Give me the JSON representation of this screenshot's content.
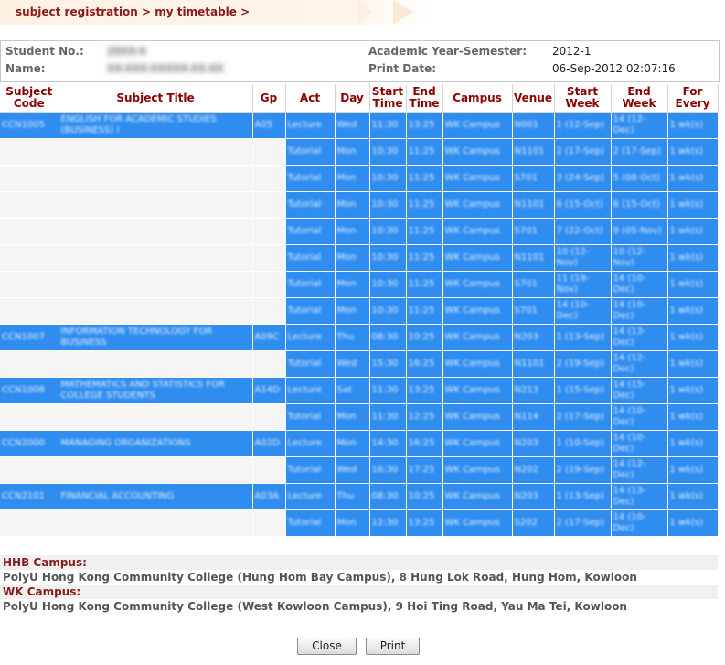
{
  "breadcrumb": "subject registration > my timetable >",
  "info": {
    "student_no_label": "Student No.:",
    "student_no_value": "20XX-X",
    "name_label": "Name:",
    "name_value": "XX-XXX-XXXXX-XX-XX",
    "year_label": "Academic Year-Semester:",
    "year_value": "2012-1",
    "print_label": "Print Date:",
    "print_value": "06-Sep-2012 02:07:16"
  },
  "columns": [
    "Subject Code",
    "Subject Title",
    "Gp",
    "Act",
    "Day",
    "Start Time",
    "End Time",
    "Campus",
    "Venue",
    "Start Week",
    "End Week",
    "For Every"
  ],
  "rows": [
    {
      "code": "CCN1005",
      "title": "ENGLISH FOR ACADEMIC STUDIES (BUSINESS) I",
      "gp": "A05",
      "act": "Lecture",
      "day": "Wed",
      "start": "11:30",
      "end": "13:25",
      "campus": "WK Campus",
      "venue": "N001",
      "sw": "1 (12-Sep)",
      "ew": "14 (12-Dec)",
      "every": "1 wk(s)"
    },
    {
      "code": "",
      "title": "",
      "gp": "",
      "act": "Tutorial",
      "day": "Mon",
      "start": "10:30",
      "end": "11:25",
      "campus": "WK Campus",
      "venue": "N1101",
      "sw": "2 (17-Sep)",
      "ew": "2 (17-Sep)",
      "every": "1 wk(s)"
    },
    {
      "code": "",
      "title": "",
      "gp": "",
      "act": "Tutorial",
      "day": "Mon",
      "start": "10:30",
      "end": "11:25",
      "campus": "WK Campus",
      "venue": "S701",
      "sw": "3 (24-Sep)",
      "ew": "5 (08-Oct)",
      "every": "1 wk(s)"
    },
    {
      "code": "",
      "title": "",
      "gp": "",
      "act": "Tutorial",
      "day": "Mon",
      "start": "10:30",
      "end": "11:25",
      "campus": "WK Campus",
      "venue": "N1101",
      "sw": "6 (15-Oct)",
      "ew": "6 (15-Oct)",
      "every": "1 wk(s)"
    },
    {
      "code": "",
      "title": "",
      "gp": "",
      "act": "Tutorial",
      "day": "Mon",
      "start": "10:30",
      "end": "11:25",
      "campus": "WK Campus",
      "venue": "S701",
      "sw": "7 (22-Oct)",
      "ew": "9 (05-Nov)",
      "every": "1 wk(s)"
    },
    {
      "code": "",
      "title": "",
      "gp": "",
      "act": "Tutorial",
      "day": "Mon",
      "start": "10:30",
      "end": "11:25",
      "campus": "WK Campus",
      "venue": "N1101",
      "sw": "10 (12-Nov)",
      "ew": "10 (12-Nov)",
      "every": "1 wk(s)"
    },
    {
      "code": "",
      "title": "",
      "gp": "",
      "act": "Tutorial",
      "day": "Mon",
      "start": "10:30",
      "end": "11:25",
      "campus": "WK Campus",
      "venue": "S701",
      "sw": "11 (19-Nov)",
      "ew": "14 (10-Dec)",
      "every": "1 wk(s)"
    },
    {
      "code": "",
      "title": "",
      "gp": "",
      "act": "Tutorial",
      "day": "Mon",
      "start": "10:30",
      "end": "11:25",
      "campus": "WK Campus",
      "venue": "S701",
      "sw": "14 (10-Dec)",
      "ew": "14 (10-Dec)",
      "every": "1 wk(s)"
    },
    {
      "code": "CCN1007",
      "title": "INFORMATION TECHNOLOGY FOR BUSINESS",
      "gp": "A09C",
      "act": "Lecture",
      "day": "Thu",
      "start": "08:30",
      "end": "10:25",
      "campus": "WK Campus",
      "venue": "N203",
      "sw": "1 (13-Sep)",
      "ew": "14 (13-Dec)",
      "every": "1 wk(s)"
    },
    {
      "code": "",
      "title": "",
      "gp": "",
      "act": "Tutorial",
      "day": "Wed",
      "start": "15:30",
      "end": "16:25",
      "campus": "WK Campus",
      "venue": "N1101",
      "sw": "2 (19-Sep)",
      "ew": "14 (12-Dec)",
      "every": "1 wk(s)"
    },
    {
      "code": "CCN1008",
      "title": "MATHEMATICS AND STATISTICS FOR COLLEGE STUDENTS",
      "gp": "A14D",
      "act": "Lecture",
      "day": "Sat",
      "start": "11:30",
      "end": "13:25",
      "campus": "WK Campus",
      "venue": "N213",
      "sw": "1 (15-Sep)",
      "ew": "14 (15-Dec)",
      "every": "1 wk(s)"
    },
    {
      "code": "",
      "title": "",
      "gp": "",
      "act": "Tutorial",
      "day": "Mon",
      "start": "11:30",
      "end": "12:25",
      "campus": "WK Campus",
      "venue": "N114",
      "sw": "2 (17-Sep)",
      "ew": "14 (10-Dec)",
      "every": "1 wk(s)"
    },
    {
      "code": "CCN2000",
      "title": "MANAGING ORGANIZATIONS",
      "gp": "A02D",
      "act": "Lecture",
      "day": "Mon",
      "start": "14:30",
      "end": "16:25",
      "campus": "WK Campus",
      "venue": "N203",
      "sw": "1 (10-Sep)",
      "ew": "14 (10-Dec)",
      "every": "1 wk(s)"
    },
    {
      "code": "",
      "title": "",
      "gp": "",
      "act": "Tutorial",
      "day": "Wed",
      "start": "16:30",
      "end": "17:25",
      "campus": "WK Campus",
      "venue": "N202",
      "sw": "2 (19-Sep)",
      "ew": "14 (12-Dec)",
      "every": "1 wk(s)"
    },
    {
      "code": "CCN2101",
      "title": "FINANCIAL ACCOUNTING",
      "gp": "A03A",
      "act": "Lecture",
      "day": "Thu",
      "start": "08:30",
      "end": "10:25",
      "campus": "WK Campus",
      "venue": "N203",
      "sw": "1 (13-Sep)",
      "ew": "14 (13-Dec)",
      "every": "1 wk(s)"
    },
    {
      "code": "",
      "title": "",
      "gp": "",
      "act": "Tutorial",
      "day": "Mon",
      "start": "12:30",
      "end": "13:25",
      "campus": "WK Campus",
      "venue": "S202",
      "sw": "2 (17-Sep)",
      "ew": "14 (10-Dec)",
      "every": "1 wk(s)"
    }
  ],
  "campuses": [
    {
      "heading": "HHB Campus:",
      "address": "PolyU Hong Kong Community College (Hung Hom Bay Campus), 8 Hung Lok Road, Hung Hom, Kowloon"
    },
    {
      "heading": "WK Campus:",
      "address": "PolyU Hong Kong Community College (West Kowloon Campus), 9 Hoi Ting Road, Yau Ma Tei, Kowloon"
    }
  ],
  "buttons": {
    "close": "Close",
    "print": "Print"
  },
  "colors": {
    "selection": "#2f8df0",
    "heading": "#8b0000"
  }
}
